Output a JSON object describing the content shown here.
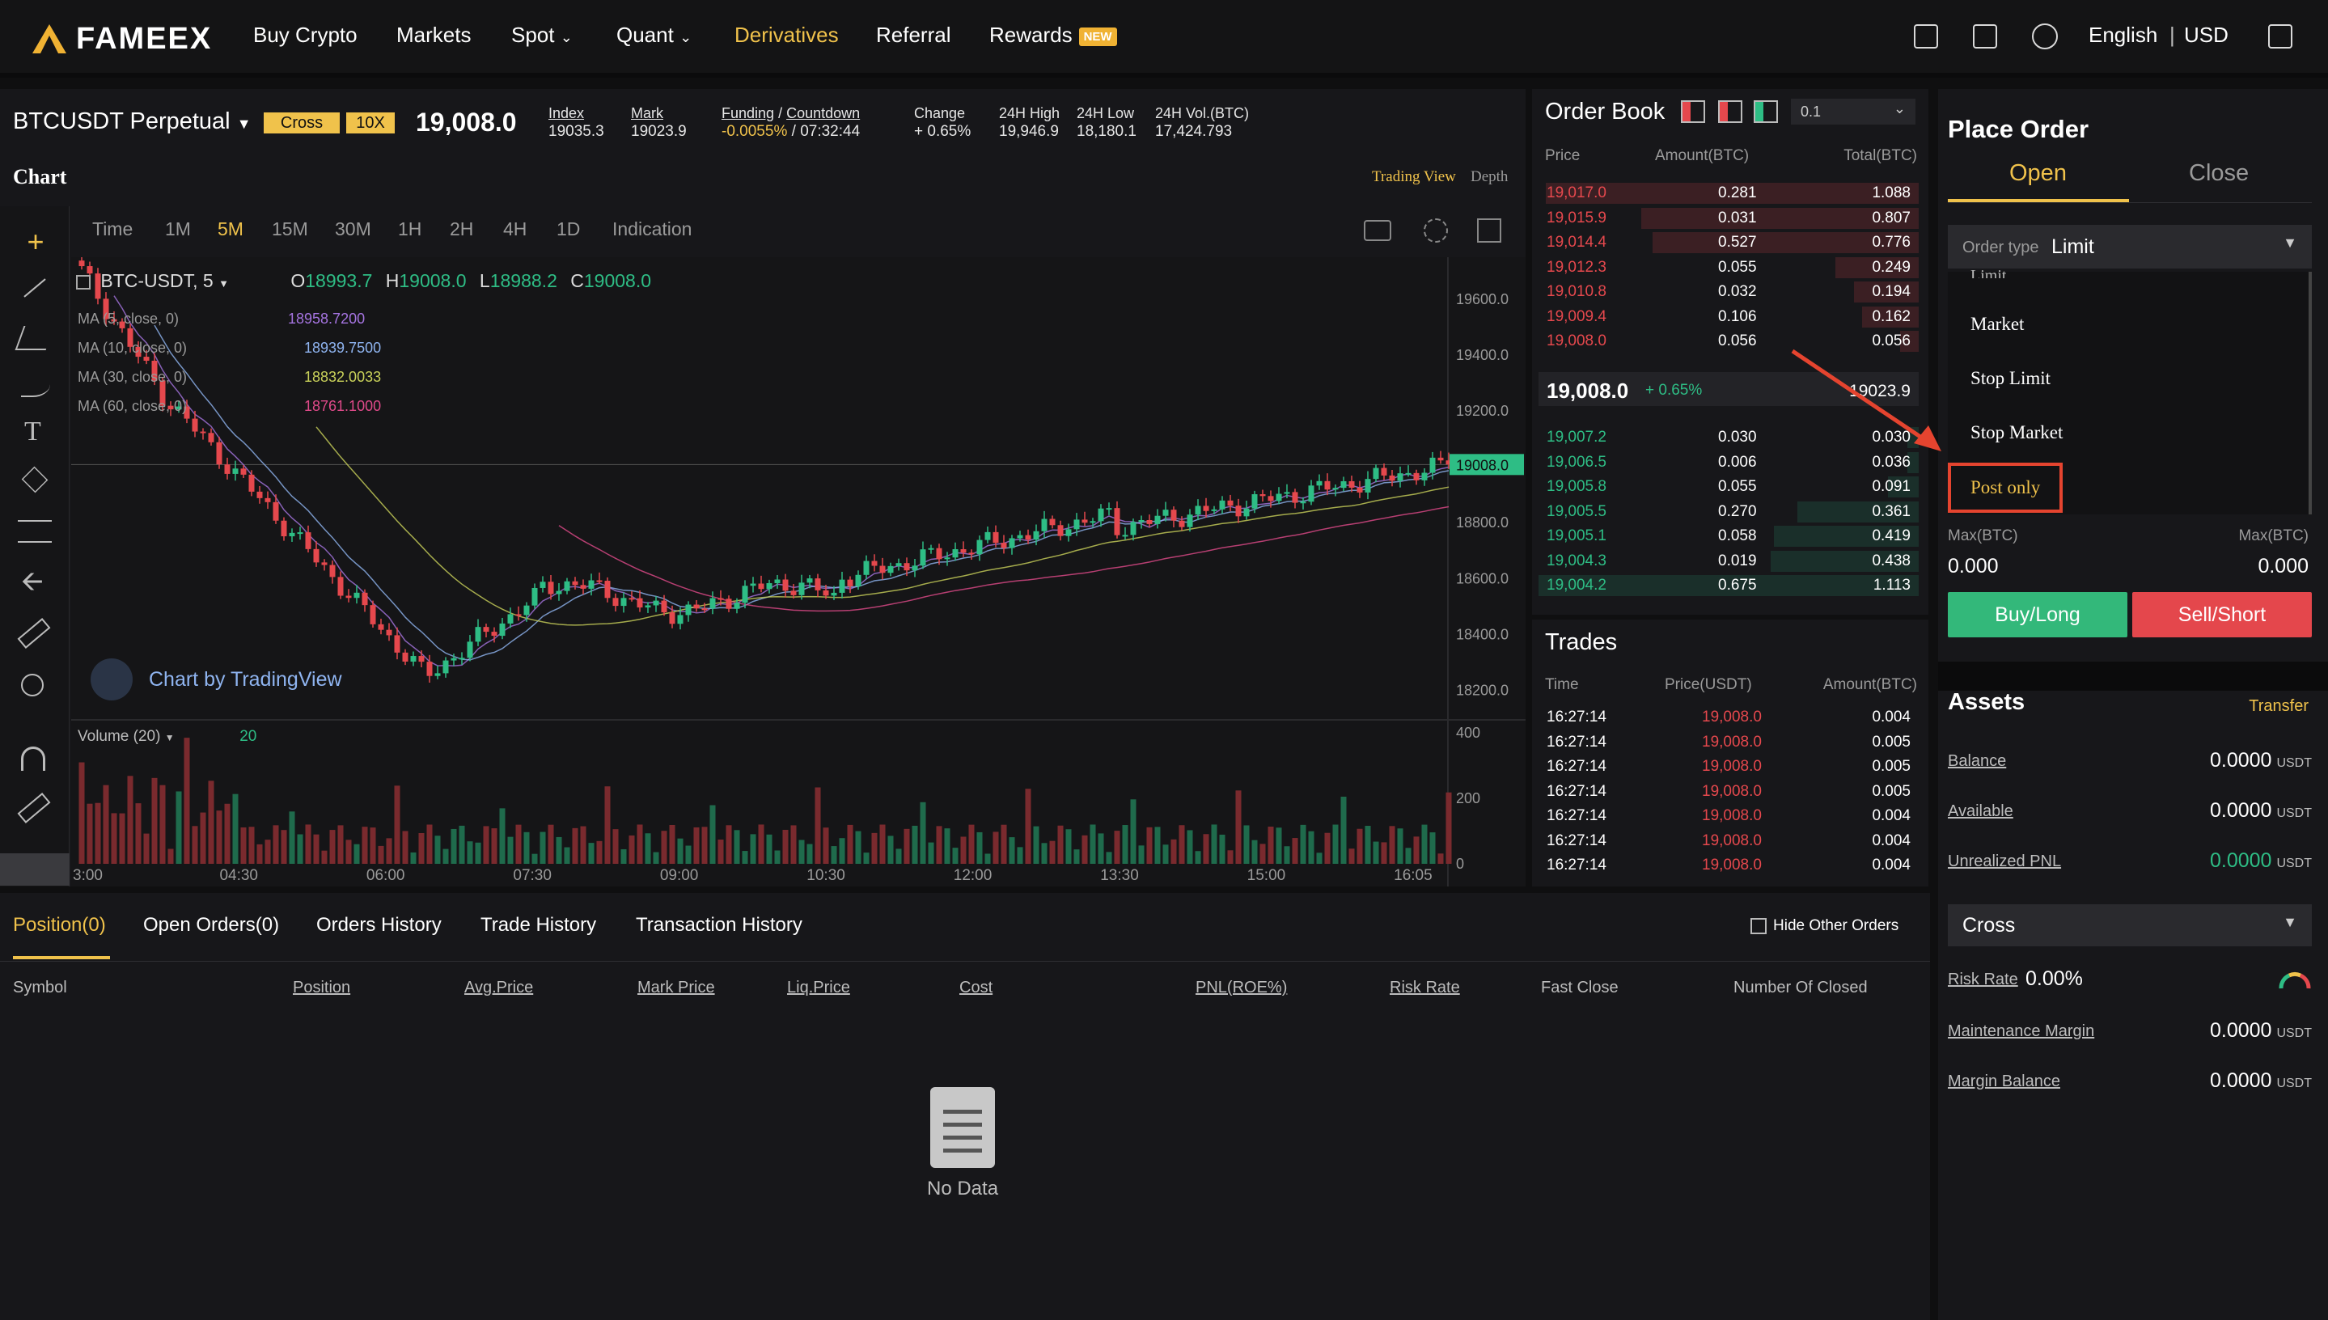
{
  "nav": {
    "brand": "FAMEEX",
    "items": [
      "Buy Crypto",
      "Markets",
      "Spot",
      "Quant",
      "Derivatives",
      "Referral",
      "Rewards"
    ],
    "active": "Derivatives",
    "new_badge": "NEW",
    "language": "English",
    "currency": "USD"
  },
  "ticker": {
    "symbol": "BTCUSDT Perpetual",
    "margin_mode": "Cross",
    "leverage": "10X",
    "last_price": "19,008.0",
    "index_label": "Index",
    "index_value": "19035.3",
    "mark_label": "Mark",
    "mark_value": "19023.9",
    "funding_label": "Funding",
    "countdown_label": "Countdown",
    "funding_value": "-0.0055%",
    "countdown_value": "07:32:44",
    "change_label": "Change",
    "change_value": "+ 0.65%",
    "high_label": "24H High",
    "high_value": "19,946.9",
    "low_label": "24H Low",
    "low_value": "18,180.1",
    "vol_label": "24H Vol.(BTC)",
    "vol_value": "17,424.793"
  },
  "chart": {
    "title": "Chart",
    "view_tabs": [
      "Trading View",
      "Depth"
    ],
    "intervals": [
      "Time",
      "1M",
      "5M",
      "15M",
      "30M",
      "1H",
      "2H",
      "4H",
      "1D",
      "Indication"
    ],
    "active_interval": "5M",
    "legend_symbol": "BTC-USDT, 5",
    "ohlc": {
      "o": "18993.7",
      "h": "19008.0",
      "l": "18988.2",
      "c": "19008.0"
    },
    "ma_lines": [
      {
        "label": "MA (5, close, 0)",
        "value": "18958.7200",
        "color": "#a574e0"
      },
      {
        "label": "MA (10, close, 0)",
        "value": "18939.7500",
        "color": "#8fb4f0"
      },
      {
        "label": "MA (30, close, 0)",
        "value": "18832.0033",
        "color": "#c9d15a"
      },
      {
        "label": "MA (60, close, 0)",
        "value": "18761.1000",
        "color": "#e04a8a"
      }
    ],
    "price_axis": [
      "19600.0",
      "19400.0",
      "19200.0",
      "19000.0",
      "18800.0",
      "18600.0",
      "18400.0",
      "18200.0"
    ],
    "current_price_tag": "19008.0",
    "volume_label": "Volume (20)",
    "volume_value": "20",
    "volume_axis": [
      "400",
      "200",
      "0"
    ],
    "time_axis": [
      "3:00",
      "04:30",
      "06:00",
      "07:30",
      "09:00",
      "10:30",
      "12:00",
      "13:30",
      "15:00",
      "16:05"
    ],
    "watermark": "Chart by TradingView"
  },
  "order_book": {
    "title": "Order Book",
    "precision": "0.1",
    "headers": [
      "Price",
      "Amount(BTC)",
      "Total(BTC)"
    ],
    "asks": [
      [
        "19,017.0",
        "0.281",
        "1.088"
      ],
      [
        "19,015.9",
        "0.031",
        "0.807"
      ],
      [
        "19,014.4",
        "0.527",
        "0.776"
      ],
      [
        "19,012.3",
        "0.055",
        "0.249"
      ],
      [
        "19,010.8",
        "0.032",
        "0.194"
      ],
      [
        "19,009.4",
        "0.106",
        "0.162"
      ],
      [
        "19,008.0",
        "0.056",
        "0.056"
      ]
    ],
    "mid_price": "19,008.0",
    "mid_change": "+ 0.65%",
    "mid_mark": "19023.9",
    "bids": [
      [
        "19,007.2",
        "0.030",
        "0.030"
      ],
      [
        "19,006.5",
        "0.006",
        "0.036"
      ],
      [
        "19,005.8",
        "0.055",
        "0.091"
      ],
      [
        "19,005.5",
        "0.270",
        "0.361"
      ],
      [
        "19,005.1",
        "0.058",
        "0.419"
      ],
      [
        "19,004.3",
        "0.019",
        "0.438"
      ],
      [
        "19,004.2",
        "0.675",
        "1.113"
      ]
    ]
  },
  "trades": {
    "title": "Trades",
    "headers": [
      "Time",
      "Price(USDT)",
      "Amount(BTC)"
    ],
    "rows": [
      [
        "16:27:14",
        "19,008.0",
        "0.004"
      ],
      [
        "16:27:14",
        "19,008.0",
        "0.005"
      ],
      [
        "16:27:14",
        "19,008.0",
        "0.005"
      ],
      [
        "16:27:14",
        "19,008.0",
        "0.005"
      ],
      [
        "16:27:14",
        "19,008.0",
        "0.004"
      ],
      [
        "16:27:14",
        "19,008.0",
        "0.004"
      ],
      [
        "16:27:14",
        "19,008.0",
        "0.004"
      ]
    ]
  },
  "place_order": {
    "title": "Place Order",
    "tabs": [
      "Open",
      "Close"
    ],
    "order_type_label": "Order type",
    "order_type_value": "Limit",
    "dropdown_options": [
      "Limit",
      "Market",
      "Stop Limit",
      "Stop Market",
      "Post only"
    ],
    "max_label": "Max(BTC)",
    "max_left": "0.000",
    "max_right": "0.000",
    "buy_label": "Buy/Long",
    "sell_label": "Sell/Short"
  },
  "assets": {
    "title": "Assets",
    "transfer": "Transfer",
    "unit": "USDT",
    "balance_label": "Balance",
    "balance": "0.0000",
    "available_label": "Available",
    "available": "0.0000",
    "upnl_label": "Unrealized PNL",
    "upnl": "0.0000",
    "mode": "Cross",
    "risk_label": "Risk Rate",
    "risk_value": "0.00%",
    "mm_label": "Maintenance Margin",
    "mm": "0.0000",
    "mb_label": "Margin Balance",
    "mb": "0.0000"
  },
  "positions": {
    "tabs": [
      "Position(0)",
      "Open Orders(0)",
      "Orders History",
      "Trade History",
      "Transaction History"
    ],
    "hide_other": "Hide Other Orders",
    "columns": [
      "Symbol",
      "Position",
      "Avg.Price",
      "Mark Price",
      "Liq.Price",
      "Cost",
      "PNL(ROE%)",
      "Risk Rate",
      "Fast Close",
      "Number Of Closed"
    ],
    "empty": "No Data"
  },
  "colors": {
    "accent": "#f0c24b",
    "up": "#2ebd85",
    "down": "#e5484d",
    "bg": "#17171a"
  }
}
